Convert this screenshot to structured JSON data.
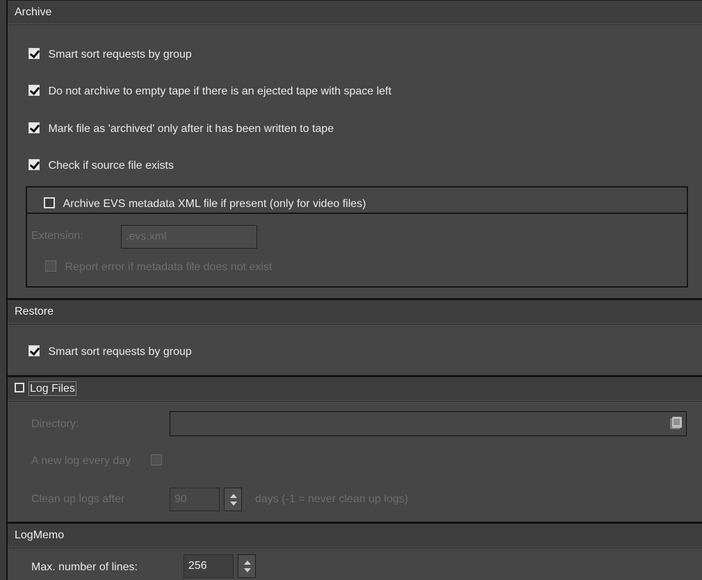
{
  "archive": {
    "header": "Archive",
    "options": [
      {
        "label": "Smart sort requests by group",
        "checked": true
      },
      {
        "label": "Do not archive to empty tape if there is an ejected tape with space left",
        "checked": true
      },
      {
        "label": "Mark file as 'archived' only after it has been written to tape",
        "checked": true
      },
      {
        "label": "Check if source file exists",
        "checked": true
      }
    ],
    "evs": {
      "label": "Archive EVS metadata XML file if present (only for video files)",
      "checked": false,
      "extension_label": "Extension:",
      "extension_value": ".evs.xml",
      "report_label": "Report error if metadata file does not exist",
      "report_checked": false
    }
  },
  "restore": {
    "header": "Restore",
    "option": {
      "label": "Smart sort requests by group",
      "checked": true
    }
  },
  "log_files": {
    "header": "Log Files",
    "enabled": false,
    "directory_label": "Directory:",
    "directory_value": "",
    "new_log_label": "A new log every day",
    "new_log_checked": false,
    "cleanup_label": "Clean up logs after",
    "cleanup_value": "90",
    "cleanup_suffix": "days (-1 = never clean up logs)"
  },
  "logmemo": {
    "header": "LogMemo",
    "max_lines_label": "Max. number of lines:",
    "max_lines_value": "256"
  },
  "icons": {
    "checkbox_checked": "checkmark-icon",
    "folder": "folder-browse-icon",
    "spin": "spinner-arrows-icon"
  }
}
